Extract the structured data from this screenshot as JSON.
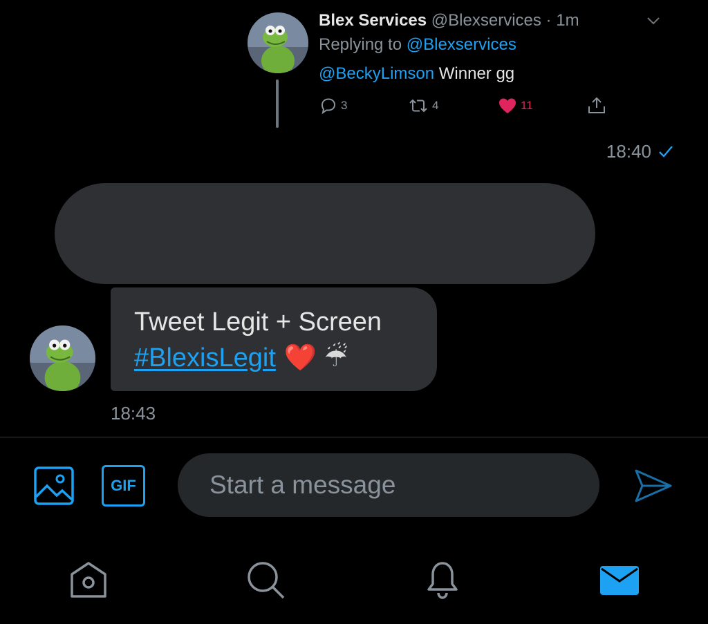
{
  "shared_tweet": {
    "author_name": "Blex Services",
    "author_handle": "@Blexservices",
    "separator": "·",
    "time": "1m",
    "replying_label": "Replying to",
    "replying_to": "@Blexservices",
    "mention": "@BeckyLimson",
    "text": "Winner gg",
    "reply_count": "3",
    "retweet_count": "4",
    "like_count": "11"
  },
  "conversation": {
    "sent_time": "18:40",
    "received_message": {
      "line1": "Tweet Legit + Screen",
      "hashtag": "#BlexisLegit",
      "emoji": "❤️ ☔",
      "time": "18:43"
    }
  },
  "composer": {
    "gif_label": "GIF",
    "placeholder": "Start a message"
  },
  "icons": {
    "reply": "reply-icon",
    "retweet": "retweet-icon",
    "like": "heart-icon",
    "share": "share-icon",
    "image": "image-icon",
    "send": "send-icon",
    "home": "home-icon",
    "search": "search-icon",
    "notifications": "bell-icon",
    "messages": "mail-icon"
  },
  "colors": {
    "accent": "#1da1f2",
    "like": "#e0245e",
    "bubble": "#2e3033",
    "background": "#000000"
  }
}
